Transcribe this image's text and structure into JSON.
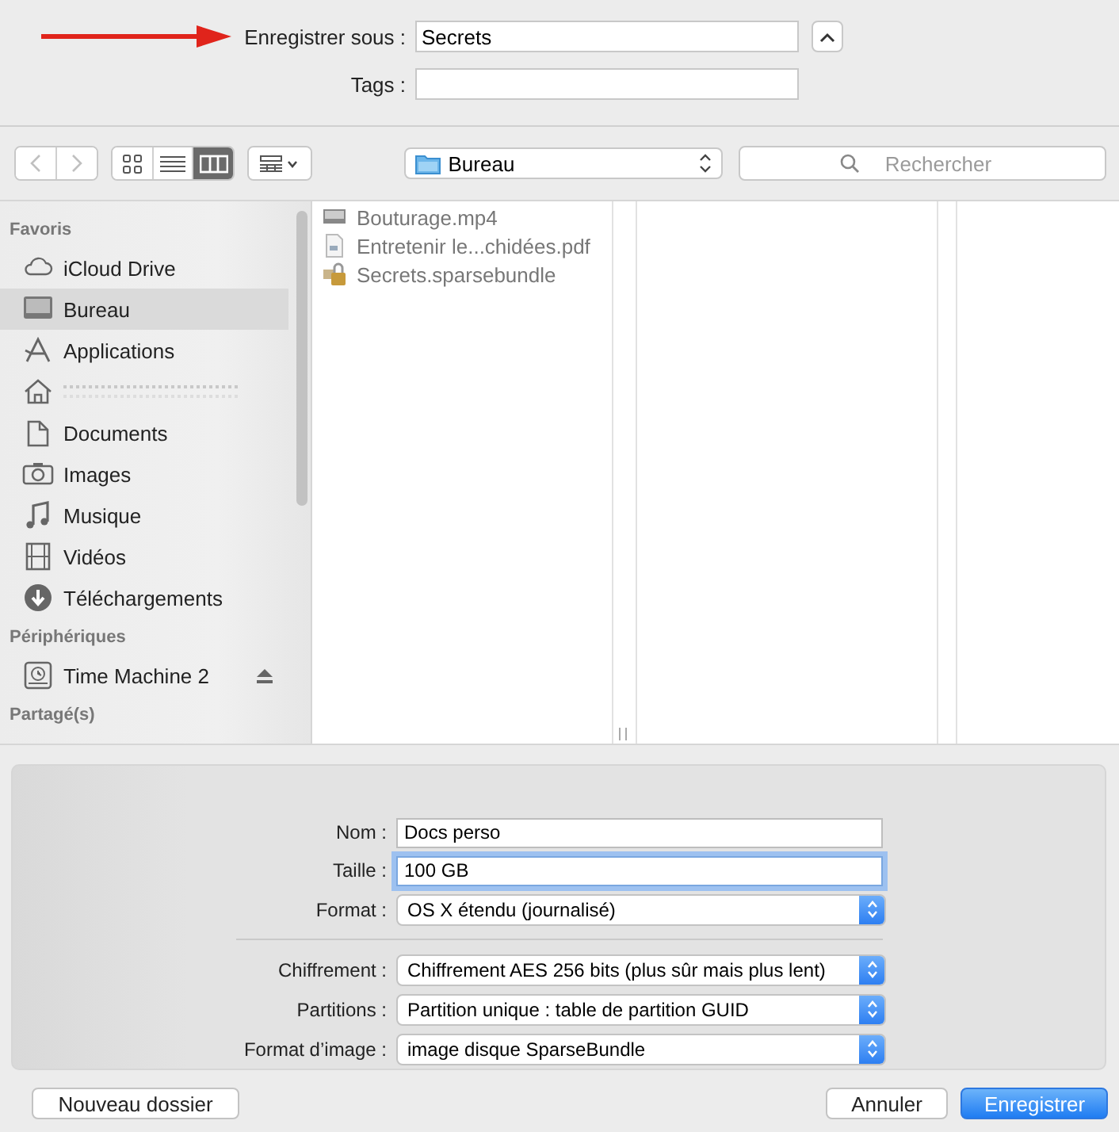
{
  "save_as": {
    "label": "Enregistrer sous :",
    "value": "Secrets"
  },
  "tags": {
    "label": "Tags :"
  },
  "toolbar": {
    "back": {
      "disabled": true
    },
    "forward": {
      "disabled": true
    },
    "views": [
      {
        "kind": "icons",
        "selected": false
      },
      {
        "kind": "list",
        "selected": false
      },
      {
        "kind": "columns",
        "selected": true
      }
    ],
    "location": "Bureau",
    "search": {
      "placeholder": "Rechercher"
    }
  },
  "sidebar": [
    {
      "heading": "Favoris",
      "items": [
        {
          "kind": "cloud",
          "label": "iCloud Drive",
          "selected": false
        },
        {
          "kind": "desktop",
          "label": "Bureau",
          "selected": true
        },
        {
          "kind": "apps",
          "label": "Applications",
          "selected": false
        },
        {
          "kind": "home",
          "selected": false
        },
        {
          "kind": "documents",
          "label": "Documents",
          "selected": false
        },
        {
          "kind": "camera",
          "label": "Images",
          "selected": false
        },
        {
          "kind": "music",
          "label": "Musique",
          "selected": false
        },
        {
          "kind": "film",
          "label": "Vidéos",
          "selected": false
        },
        {
          "kind": "download",
          "label": "Téléchargements",
          "selected": false
        }
      ]
    },
    {
      "heading": "Périphériques",
      "items": [
        {
          "kind": "disk",
          "label": "Time Machine 2",
          "selected": false,
          "ejectable": true
        }
      ]
    },
    {
      "heading": "Partagé(s)"
    }
  ],
  "files": [
    {
      "kind": "video",
      "name": "Bouturage.mp4"
    },
    {
      "kind": "pdf",
      "name": "Entretenir le...chidées.pdf"
    },
    {
      "kind": "bundle",
      "name": "Secrets.sparsebundle"
    }
  ],
  "options": [
    {
      "kind": "text",
      "label": "Nom :",
      "value": "Docs perso",
      "focused": false
    },
    {
      "kind": "text",
      "label": "Taille :",
      "value": "100 GB",
      "focused": true
    },
    {
      "kind": "popup",
      "label": "Format :",
      "value": "OS X étendu (journalisé)"
    },
    {
      "kind": "divider"
    },
    {
      "kind": "popup",
      "label": "Chiffrement :",
      "value": "Chiffrement AES 256 bits (plus sûr mais plus lent)"
    },
    {
      "kind": "popup",
      "label": "Partitions :",
      "value": "Partition unique : table de partition GUID"
    },
    {
      "kind": "popup",
      "label": "Format d’image :",
      "value": "image disque SparseBundle"
    }
  ],
  "buttons": {
    "new_folder": "Nouveau dossier",
    "cancel": "Annuler",
    "save": "Enregistrer"
  }
}
